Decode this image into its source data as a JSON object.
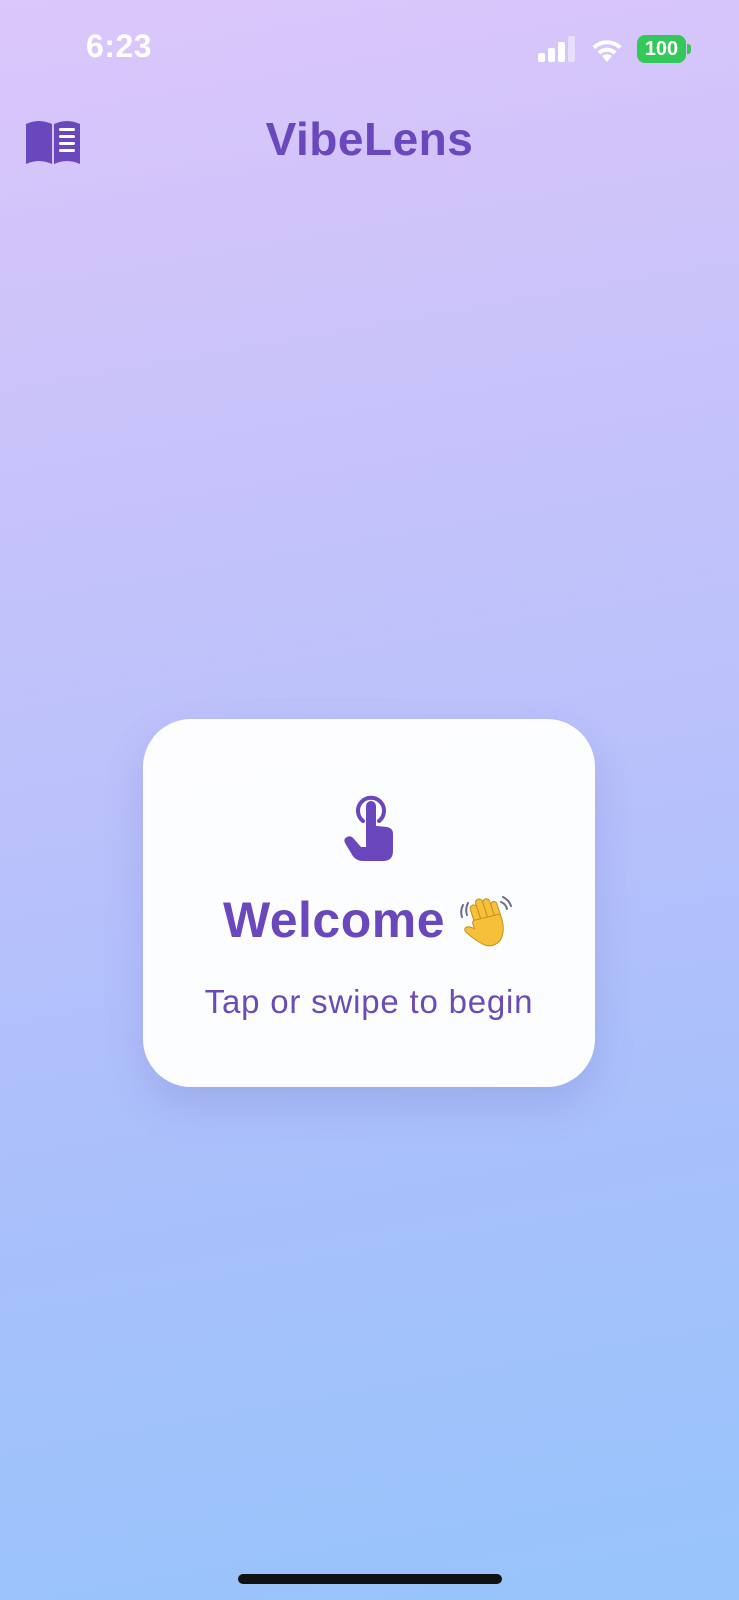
{
  "status_bar": {
    "time": "6:23",
    "battery_level": "100",
    "signal_icon": "cellular-signal-icon",
    "wifi_icon": "wifi-icon",
    "battery_color": "#34c759"
  },
  "nav": {
    "title": "VibeLens",
    "left_icon": "book-icon"
  },
  "welcome_card": {
    "icon": "tap-hand-icon",
    "title": "Welcome",
    "emoji_icon": "waving-hand-icon",
    "subtitle": "Tap or swipe to begin"
  },
  "colors": {
    "accent": "#6a47bd",
    "card_background": "#ffffff",
    "gradient_top": "#dcc6fb",
    "gradient_bottom": "#97c4fb"
  }
}
